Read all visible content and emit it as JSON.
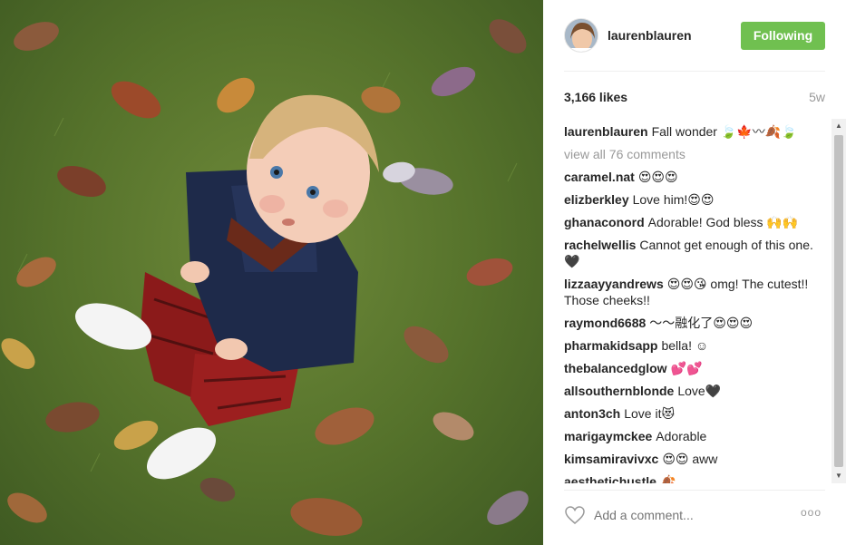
{
  "header": {
    "username": "laurenblauren",
    "follow_label": "Following"
  },
  "post": {
    "likes": "3,166 likes",
    "time_ago": "5w"
  },
  "caption": {
    "user": "laurenblauren",
    "text": "Fall wonder 🍃🍁〰🍂🍃"
  },
  "view_all": "view all 76 comments",
  "comments": [
    {
      "user": "caramel.nat",
      "text": "😍😍😍"
    },
    {
      "user": "elizberkley",
      "text": "Love him!😍😍"
    },
    {
      "user": "ghanaconord",
      "text": "Adorable! God bless 🙌🙌"
    },
    {
      "user": "rachelwellis",
      "text": "Cannot get enough of this one. 🖤"
    },
    {
      "user": "lizzaayyandrews",
      "text": "😍😍😘 omg! The cutest!! Those cheeks!!"
    },
    {
      "user": "raymond6688",
      "text": "〜〜融化了😍😍😍"
    },
    {
      "user": "pharmakidsapp",
      "text": "bella! ☺"
    },
    {
      "user": "thebalancedglow",
      "text": "💕💕"
    },
    {
      "user": "allsouthernblonde",
      "text": "Love🖤"
    },
    {
      "user": "anton3ch",
      "text": "Love it😻"
    },
    {
      "user": "marigaymckee",
      "text": "Adorable"
    },
    {
      "user": "kimsamiravivxc",
      "text": "😍😍 aww"
    },
    {
      "user": "aesthetichustle",
      "text": "🍂"
    }
  ],
  "add_comment_placeholder": "Add a comment...",
  "more_label": "ooo",
  "icons": {
    "heart": "heart-icon",
    "more": "more-options-icon",
    "scroll_up": "scroll-up-arrow-icon",
    "scroll_down": "scroll-down-arrow-icon"
  },
  "colors": {
    "follow_button": "#70c050",
    "muted_text": "#999999"
  }
}
